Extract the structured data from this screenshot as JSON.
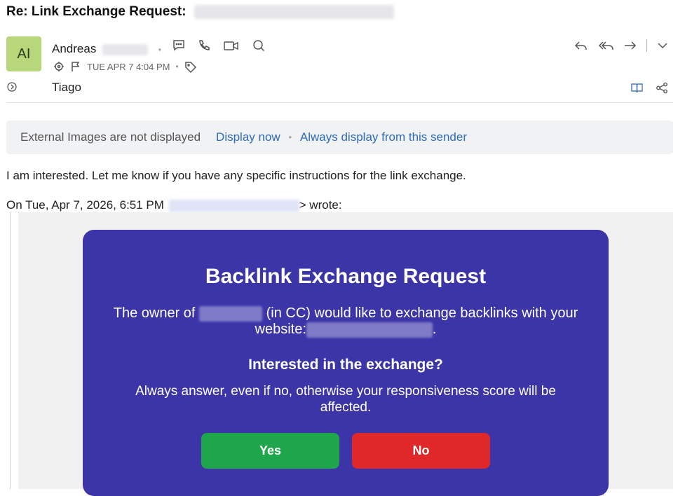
{
  "subject": {
    "prefix": "Re: Link Exchange Request:"
  },
  "sender": {
    "initials": "AI",
    "first_name": "Andreas",
    "date": "TUE APR 7 4:04 PM"
  },
  "recipient": {
    "name": "Tiago"
  },
  "external_images": {
    "message": "External Images are not displayed",
    "display_now": "Display now",
    "always_display": "Always display from this sender"
  },
  "reply": {
    "text": "I am interested. Let me know if you have any specific instructions for the link exchange."
  },
  "quote": {
    "prefix": "On Tue, Apr 7, 2026, 6:51 PM",
    "suffix": "> wrote:"
  },
  "card": {
    "title": "Backlink Exchange Request",
    "owner_prefix": "The owner of",
    "owner_suffix": "(in CC) would like to exchange backlinks with your website:",
    "period": ".",
    "question": "Interested in the exchange?",
    "note": "Always answer, even if no, otherwise your responsiveness score will be affected.",
    "yes_label": "Yes",
    "no_label": "No"
  },
  "colors": {
    "card_bg": "#3b35a8",
    "yes": "#1fa64a",
    "no": "#e0282a",
    "link": "#2e6bb8",
    "avatar": "#b7d77a"
  }
}
